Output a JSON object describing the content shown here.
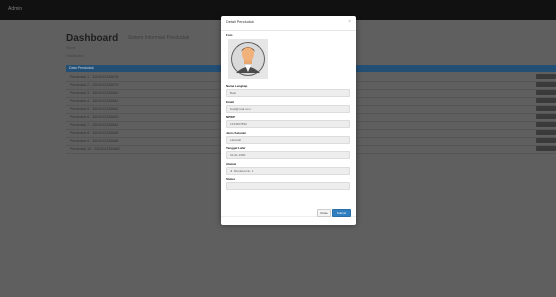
{
  "app": {
    "brand": "Admin"
  },
  "dashboard": {
    "title": "Dashboard",
    "subtitle": "Sistem Informasi Penduduk",
    "breadcrumb_home": "Home",
    "breadcrumb_page": "Dashboard"
  },
  "table": {
    "header": "Data Penduduk",
    "rows": [
      "Penduduk 1 - 3201012345678",
      "Penduduk 2 - 3201012345679",
      "Penduduk 3 - 3201012345680",
      "Penduduk 4 - 3201012345681",
      "Penduduk 5 - 3201012345682",
      "Penduduk 6 - 3201012345683",
      "Penduduk 7 - 3201012345684",
      "Penduduk 8 - 3201012345685",
      "Penduduk 9 - 3201012345686",
      "Penduduk 10 - 3201012345687"
    ]
  },
  "modal": {
    "title": "Detail Penduduk",
    "close_icon": "close-icon",
    "photo_label": "Foto",
    "photo_icon": "avatar-icon",
    "fields": [
      {
        "label": "Nama Lengkap",
        "value": "Budi"
      },
      {
        "label": "Email",
        "value": "budi@mail.com"
      },
      {
        "label": "NPWP",
        "value": "1234567890"
      },
      {
        "label": "Jenis Kelamin",
        "value": "Laki-laki"
      },
      {
        "label": "Tanggal Lahir",
        "value": "01-01-1990"
      },
      {
        "label": "Alamat",
        "value": "Jl. Merdeka No. 1"
      },
      {
        "label": "Status",
        "value": ""
      }
    ],
    "buttons": {
      "close": "Close",
      "submit": "Submit"
    }
  }
}
